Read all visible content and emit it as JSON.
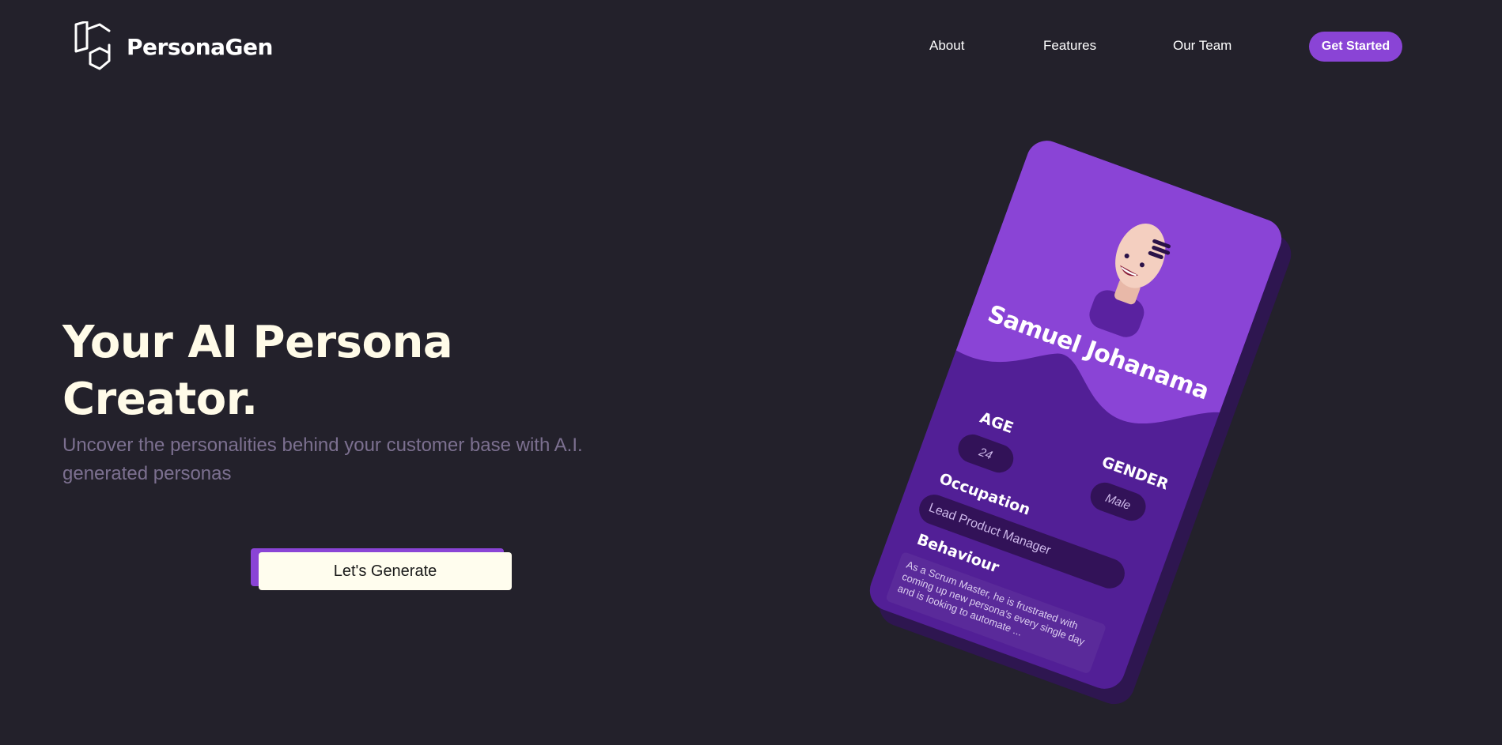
{
  "brand": {
    "name": "PersonaGen",
    "logo_icon": "pg-hexagon-logo"
  },
  "nav": {
    "items": [
      {
        "label": "About"
      },
      {
        "label": "Features"
      },
      {
        "label": "Our Team"
      }
    ],
    "cta_label": "Get Started"
  },
  "hero": {
    "title": "Your AI Persona Creator.",
    "subtitle": "Uncover the personalities behind your customer base with A.I. generated personas",
    "button_label": "Let's Generate"
  },
  "persona_card": {
    "name": "Samuel Johanama",
    "age_label": "AGE",
    "age_value": "24",
    "gender_label": "GENDER",
    "gender_value": "Male",
    "occupation_label": "Occupation",
    "occupation_value": "Lead Product Manager",
    "behaviour_label": "Behaviour",
    "behaviour_text": "As a Scrum Master, he is frustrated with coming up new persona's every single day and is looking to automate ..."
  },
  "colors": {
    "background": "#23212b",
    "accent": "#8a44d6",
    "card_dark": "#521f96",
    "cream": "#fffdee",
    "muted_text": "#7c7090"
  }
}
